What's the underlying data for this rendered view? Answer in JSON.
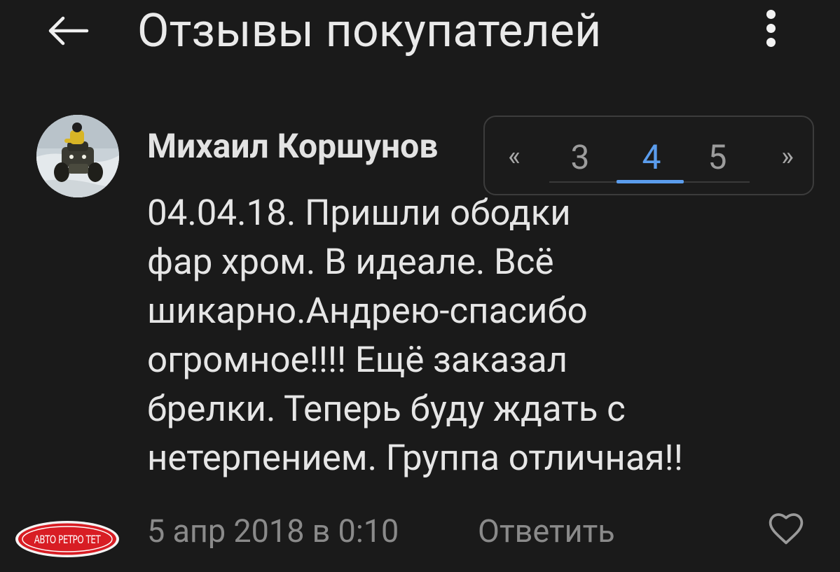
{
  "header": {
    "title": "Отзывы покупателей",
    "back_icon": "arrow-left-icon",
    "more_icon": "more-vertical-icon"
  },
  "review": {
    "author": "Михаил Коршунов",
    "text": "04.04.18. Пришли ободки\nфар хром. В идеале. Всё\nшикарно.Андрею-спасибо\nогромное!!!! Ещё заказал\nбрелки. Теперь буду ждать с\nнетерпением. Группа отличная!!",
    "date": "5 апр 2018 в 0:10",
    "reply_label": "Ответить",
    "like_icon": "heart-outline-icon"
  },
  "pager": {
    "prev": "«",
    "pages": [
      "3",
      "4",
      "5"
    ],
    "active": "4",
    "next": "»"
  },
  "logo": {
    "text": "АВТО РЕТРО ТЕТ"
  },
  "colors": {
    "background": "#1a1a1a",
    "text": "#e6e6e6",
    "muted": "#8a8a8a",
    "accent": "#5b9ded",
    "logo_red": "#d81d24"
  }
}
